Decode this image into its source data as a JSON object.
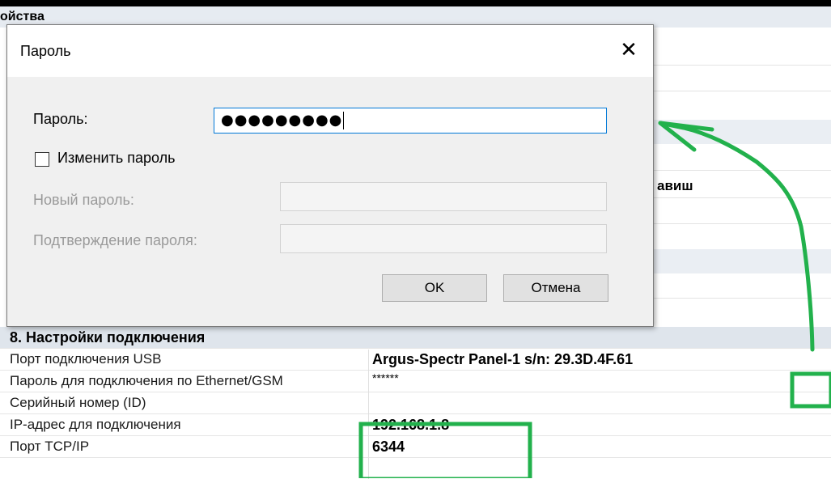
{
  "background": {
    "header_fragment": "ойства",
    "cut_text_fragment": "авиш"
  },
  "dialog": {
    "title": "Пароль",
    "close_glyph": "✕",
    "password_label": "Пароль:",
    "password_value": "●●●●●●●●●",
    "change_password_label": "Изменить пароль",
    "change_password_checked": false,
    "new_password_label": "Новый пароль:",
    "confirm_password_label": "Подтверждение пароля:",
    "ok_label": "OK",
    "cancel_label": "Отмена"
  },
  "table": {
    "section_title": "8. Настройки подключения",
    "rows": [
      {
        "label": "Порт подключения USB",
        "value": "Argus-Spectr Panel-1 s/n: 29.3D.4F.61"
      },
      {
        "label": "Пароль для подключения по Ethernet/GSM",
        "value": "******"
      },
      {
        "label": "Серийный номер (ID)",
        "value": ""
      },
      {
        "label": "IP-адрес для подключения",
        "value": "192.168.1.8"
      },
      {
        "label": "Порт TCP/IP",
        "value": "6344"
      }
    ]
  },
  "colors": {
    "annotation": "#22b14c",
    "focus_border": "#0078d7",
    "section_bg": "#dfe5ec"
  }
}
